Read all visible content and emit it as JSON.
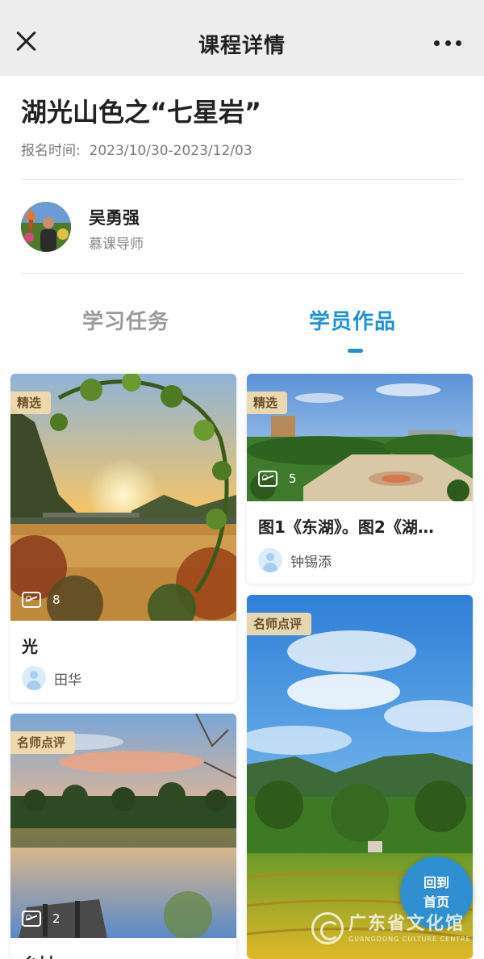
{
  "header": {
    "title": "课程详情"
  },
  "course": {
    "title": "湖光山色之“七星岩”",
    "enroll_label": "报名时间:",
    "enroll_period": "2023/10/30-2023/12/03"
  },
  "tutor": {
    "name": "吴勇强",
    "role": "慕课导师"
  },
  "tabs": [
    {
      "label": "学习任务",
      "active": false
    },
    {
      "label": "学员作品",
      "active": true
    }
  ],
  "works": [
    {
      "badge": "精选",
      "image_count": "8",
      "title": "光",
      "author": "田华"
    },
    {
      "badge": "精选",
      "image_count": "5",
      "title": "图1《东湖》。图2《湖…",
      "author": "钟锡添"
    },
    {
      "badge": "名师点评",
      "image_count": "2",
      "title": "乡村"
    },
    {
      "badge": "名师点评"
    }
  ],
  "home_button": {
    "line1": "回到",
    "line2": "首页"
  },
  "watermark": {
    "cn": "广东省文化馆",
    "en": "GUANGDONG CULTURE CENTRE"
  },
  "colors": {
    "accent": "#1e90d6",
    "badge_bg": "#f4dcae",
    "home_button": "#2f8fd0"
  }
}
